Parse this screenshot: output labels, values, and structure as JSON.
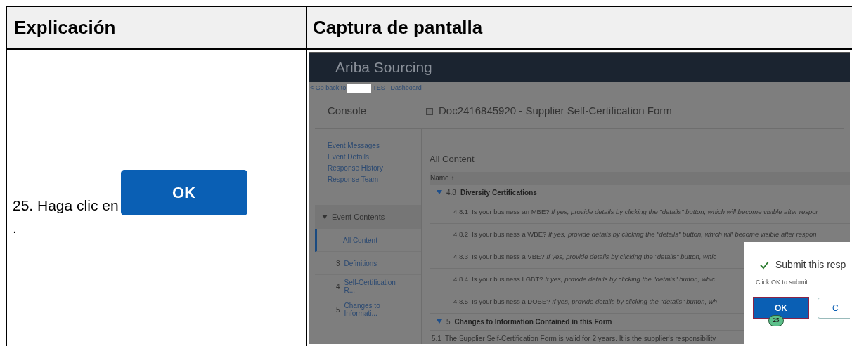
{
  "table": {
    "columns": [
      "Explicación",
      "Captura de pantalla"
    ]
  },
  "step": {
    "text": "25. Haga clic en",
    "button": "OK",
    "end": "."
  },
  "screenshot": {
    "app_title": "Ariba Sourcing",
    "back_link": {
      "before": "< Go back to",
      "after": "TEST Dashboard"
    },
    "console_title": "Console",
    "doc_title": "Doc2416845920 - Supplier Self-Certification Form",
    "sidebar_links": [
      "Event Messages",
      "Event Details",
      "Response History",
      "Response Team"
    ],
    "event_contents": {
      "label": "Event Contents",
      "expanded": true,
      "items": [
        {
          "label": "All Content",
          "selected": true
        },
        {
          "number": "3",
          "label": "Definitions",
          "selected": false
        },
        {
          "number": "4",
          "label": "Self-Certification R...",
          "selected": false
        },
        {
          "number": "5",
          "label": "Changes to Informati...",
          "selected": false
        }
      ]
    },
    "section_title": "All Content",
    "column_header": "Name ↑",
    "rows": [
      {
        "kind": "section",
        "number": "4.8",
        "title": "Diversity Certifications",
        "expanded": true
      },
      {
        "kind": "question",
        "number": "4.8.1",
        "question": "Is your business an MBE?",
        "hint": "If yes, provide details by clicking the \"details\" button, which will become visible after respor"
      },
      {
        "kind": "question",
        "number": "4.8.2",
        "question": "Is your business a WBE?",
        "hint": "If yes, provide details by clicking the \"details\" button, which will become visible after respon"
      },
      {
        "kind": "question",
        "number": "4.8.3",
        "question": "Is your business a VBE?",
        "hint": "If yes, provide details by clicking the \"details\" button, whic"
      },
      {
        "kind": "question",
        "number": "4.8.4",
        "question": "Is your business LGBT?",
        "hint": "If yes, provide details by clicking the \"details\" button, whic"
      },
      {
        "kind": "question",
        "number": "4.8.5",
        "question": "Is your business a DOBE?",
        "hint": "If yes, provide details by clicking the \"details\" button, wh"
      },
      {
        "kind": "section",
        "number": "5",
        "title": "Changes to Information Contained in this Form",
        "expanded": true
      },
      {
        "kind": "text",
        "number": "5.1",
        "text": "The Supplier Self-Certification Form is valid for 2 years. It is the supplier's responsibility"
      }
    ],
    "dialog": {
      "title": "Submit this resp",
      "message": "Click OK to submit.",
      "ok": "OK",
      "cancel": "C",
      "badge": "25"
    }
  }
}
